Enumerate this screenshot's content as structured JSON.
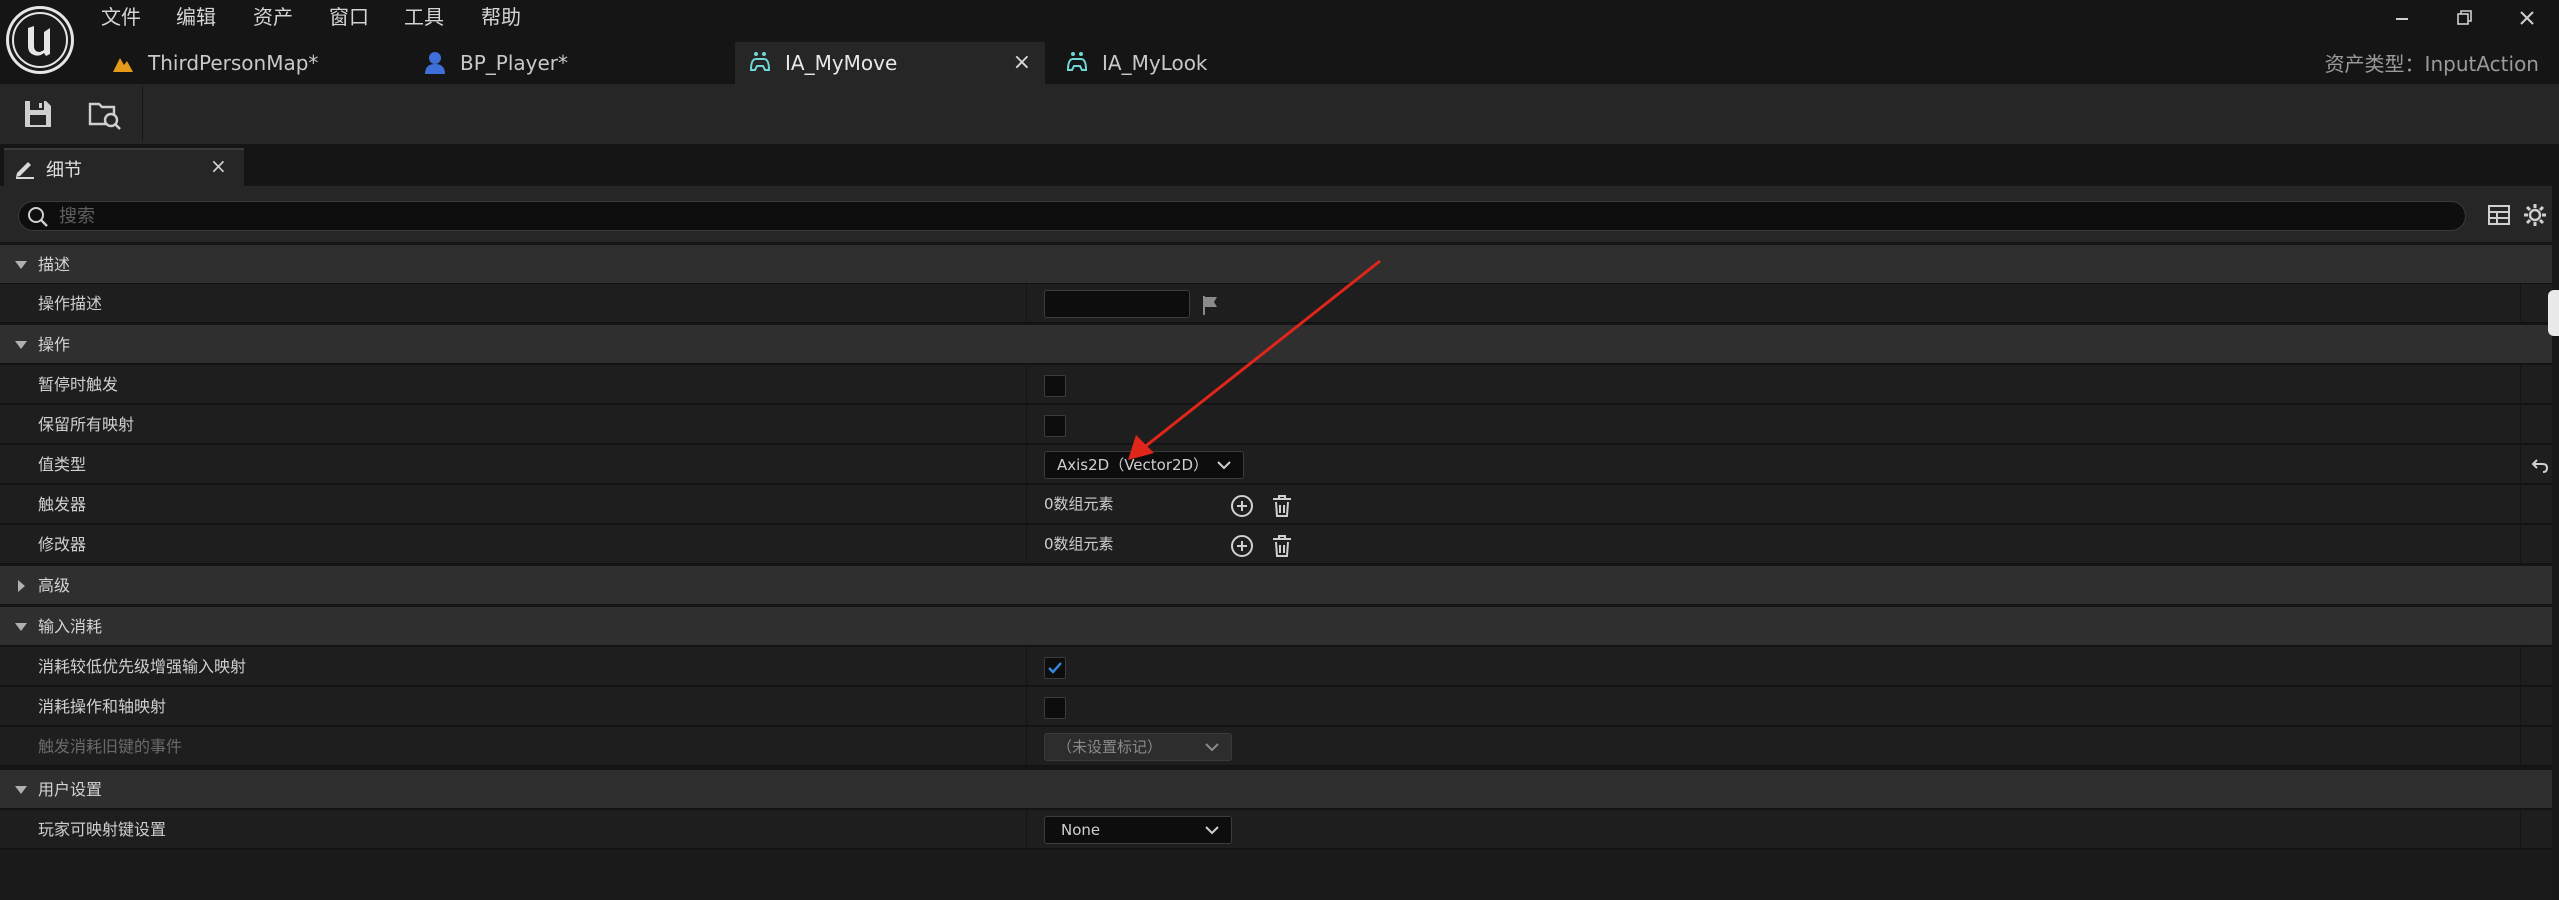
{
  "menu": [
    "文件",
    "编辑",
    "资产",
    "窗口",
    "工具",
    "帮助"
  ],
  "tabs": [
    {
      "label": "ThirdPersonMap*",
      "icon": "map-icon"
    },
    {
      "label": "BP_Player*",
      "icon": "blueprint-pawn-icon"
    },
    {
      "label": "IA_MyMove",
      "icon": "input-action-icon",
      "active": true
    },
    {
      "label": "IA_MyLook",
      "icon": "input-action-icon"
    }
  ],
  "asset_type_label": "资产类型：InputAction",
  "toolbar": {
    "save_icon": "save-icon",
    "browse_icon": "browse-to-asset-icon"
  },
  "panel": {
    "tab_label": "细节",
    "close": "×"
  },
  "search": {
    "placeholder": "搜索"
  },
  "sections": {
    "description": {
      "title": "描述",
      "action_description_label": "操作描述",
      "action_description_value": ""
    },
    "action": {
      "title": "操作",
      "trigger_when_paused_label": "暂停时触发",
      "trigger_when_paused": false,
      "reserve_all_mappings_label": "保留所有映射",
      "reserve_all_mappings": false,
      "value_type_label": "值类型",
      "value_type": "Axis2D（Vector2D）",
      "triggers_label": "触发器",
      "triggers_value": "0数组元素",
      "modifiers_label": "修改器",
      "modifiers_value": "0数组元素"
    },
    "advanced": {
      "title": "高级"
    },
    "input_consumption": {
      "title": "输入消耗",
      "consume_lower_priority_label": "消耗较低优先级增强输入映射",
      "consume_lower_priority": true,
      "consume_action_axis_label": "消耗操作和轴映射",
      "consume_action_axis": false,
      "trigger_events_label": "触发消耗旧键的事件",
      "trigger_events_value": "（未设置标记）"
    },
    "user_settings": {
      "title": "用户设置",
      "player_mappable_label": "玩家可映射键设置",
      "player_mappable_value": "None"
    }
  },
  "colors": {
    "accent": "#2f8be0",
    "annotation_arrow": "#e0251b",
    "checkbox_check": "#2f8be0"
  }
}
